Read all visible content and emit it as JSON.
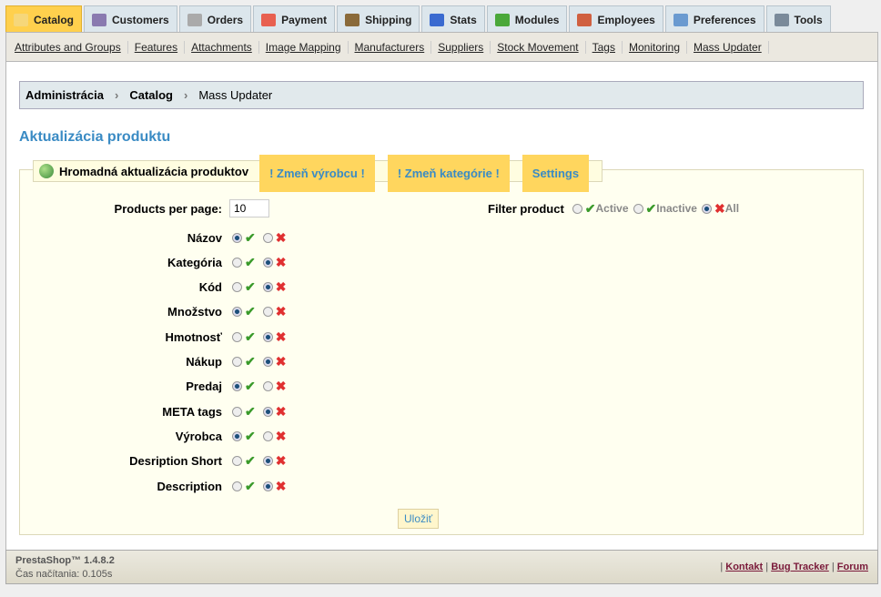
{
  "tabs": [
    {
      "label": "Catalog",
      "icon": "folder-icon",
      "color": "#f6d77a"
    },
    {
      "label": "Customers",
      "icon": "user-icon",
      "color": "#8a7ab0"
    },
    {
      "label": "Orders",
      "icon": "cart-icon",
      "color": "#aaa"
    },
    {
      "label": "Payment",
      "icon": "payment-icon",
      "color": "#e86050"
    },
    {
      "label": "Shipping",
      "icon": "truck-icon",
      "color": "#8a6a3a"
    },
    {
      "label": "Stats",
      "icon": "chart-icon",
      "color": "#3a6ad0"
    },
    {
      "label": "Modules",
      "icon": "puzzle-icon",
      "color": "#4aa83a"
    },
    {
      "label": "Employees",
      "icon": "employee-icon",
      "color": "#d06040"
    },
    {
      "label": "Preferences",
      "icon": "preferences-icon",
      "color": "#6a9ad0"
    },
    {
      "label": "Tools",
      "icon": "wrench-icon",
      "color": "#7a8a9a"
    }
  ],
  "subnav": [
    "Attributes and Groups",
    "Features",
    "Attachments",
    "Image Mapping",
    "Manufacturers",
    "Suppliers",
    "Stock Movement",
    "Tags",
    "Monitoring",
    "Mass Updater"
  ],
  "breadcrumb": [
    "Administrácia",
    "Catalog",
    "Mass Updater"
  ],
  "heading": "Aktualizácia produktu",
  "legend": {
    "title": "Hromadná aktualizácia produktov",
    "tabs": [
      "! Zmeň výrobcu !",
      "! Zmeň kategórie !",
      "Settings"
    ]
  },
  "per_page": {
    "label": "Products per page:",
    "value": "10"
  },
  "filter": {
    "label": "Filter product",
    "options": [
      "Active",
      "Inactive",
      "All"
    ],
    "selected": 2
  },
  "fields": [
    {
      "label": "Názov",
      "on": true
    },
    {
      "label": "Kategória",
      "on": false
    },
    {
      "label": "Kód",
      "on": false
    },
    {
      "label": "Množstvo",
      "on": true
    },
    {
      "label": "Hmotnosť",
      "on": false
    },
    {
      "label": "Nákup",
      "on": false
    },
    {
      "label": "Predaj",
      "on": true
    },
    {
      "label": "META tags",
      "on": false
    },
    {
      "label": "Výrobca",
      "on": true
    },
    {
      "label": "Desription Short",
      "on": false
    },
    {
      "label": "Description",
      "on": false
    }
  ],
  "save": "Uložiť",
  "footer": {
    "version": "PrestaShop™ 1.4.8.2",
    "time": "Čas načítania: 0.105s",
    "links": [
      "Kontakt",
      "Bug Tracker",
      "Forum"
    ]
  }
}
